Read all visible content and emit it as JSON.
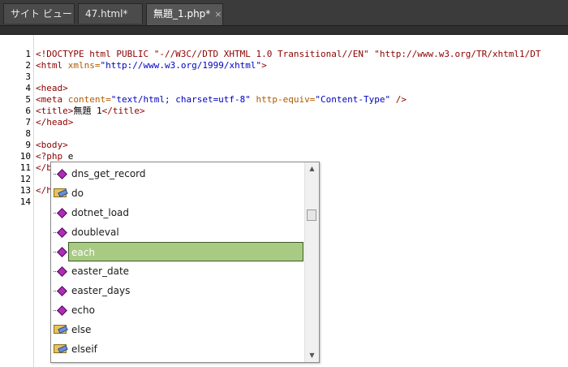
{
  "tabs": [
    {
      "label": "サイト ビュー"
    },
    {
      "label": "47.html*"
    },
    {
      "label": "無題_1.php*",
      "close": "×"
    }
  ],
  "editor": {
    "line_numbers": [
      "1",
      "2",
      "3",
      "4",
      "5",
      "6",
      "7",
      "8",
      "9",
      "10",
      "11",
      "12",
      "13",
      "14"
    ],
    "lines": [
      [
        {
          "t": "tag",
          "v": "<!DOCTYPE html PUBLIC \"-//W3C//DTD XHTML 1.0 Transitional//EN\" \"http://www.w3.org/TR/xhtml1/DT"
        }
      ],
      [
        {
          "t": "tag",
          "v": "<html "
        },
        {
          "t": "attr",
          "v": "xmlns="
        },
        {
          "t": "val",
          "v": "\"http://www.w3.org/1999/xhtml\""
        },
        {
          "t": "tag",
          "v": ">"
        }
      ],
      [],
      [
        {
          "t": "tag",
          "v": "<head>"
        }
      ],
      [
        {
          "t": "tag",
          "v": "<meta "
        },
        {
          "t": "attr",
          "v": "content="
        },
        {
          "t": "val",
          "v": "\"text/html; charset=utf-8\""
        },
        {
          "t": "attr",
          "v": " http-equiv="
        },
        {
          "t": "val",
          "v": "\"Content-Type\""
        },
        {
          "t": "tag",
          "v": " />"
        }
      ],
      [
        {
          "t": "tag",
          "v": "<title>"
        },
        {
          "t": "txt",
          "v": "無題 1"
        },
        {
          "t": "tag",
          "v": "</title>"
        }
      ],
      [
        {
          "t": "tag",
          "v": "</head>"
        }
      ],
      [],
      [
        {
          "t": "tag",
          "v": "<body>"
        }
      ],
      [
        {
          "t": "tag",
          "v": "<?php "
        },
        {
          "t": "txt",
          "v": "e"
        }
      ],
      [
        {
          "t": "tag",
          "v": "</b"
        }
      ],
      [],
      [
        {
          "t": "tag",
          "v": "</h"
        }
      ],
      []
    ]
  },
  "autocomplete": {
    "items": [
      {
        "label": "dns_get_record",
        "kind": "function"
      },
      {
        "label": "do",
        "kind": "keyword"
      },
      {
        "label": "dotnet_load",
        "kind": "function"
      },
      {
        "label": "doubleval",
        "kind": "function"
      },
      {
        "label": "each",
        "kind": "function",
        "selected": true
      },
      {
        "label": "easter_date",
        "kind": "function"
      },
      {
        "label": "easter_days",
        "kind": "function"
      },
      {
        "label": "echo",
        "kind": "function"
      },
      {
        "label": "else",
        "kind": "keyword"
      },
      {
        "label": "elseif",
        "kind": "keyword"
      }
    ],
    "scroll_up": "▲",
    "scroll_down": "▼"
  },
  "colors": {
    "selection": "#a8ca83",
    "tag": "#8b0000",
    "attribute": "#b05a00",
    "value": "#0000c0",
    "function_icon": "#b02cb8"
  }
}
